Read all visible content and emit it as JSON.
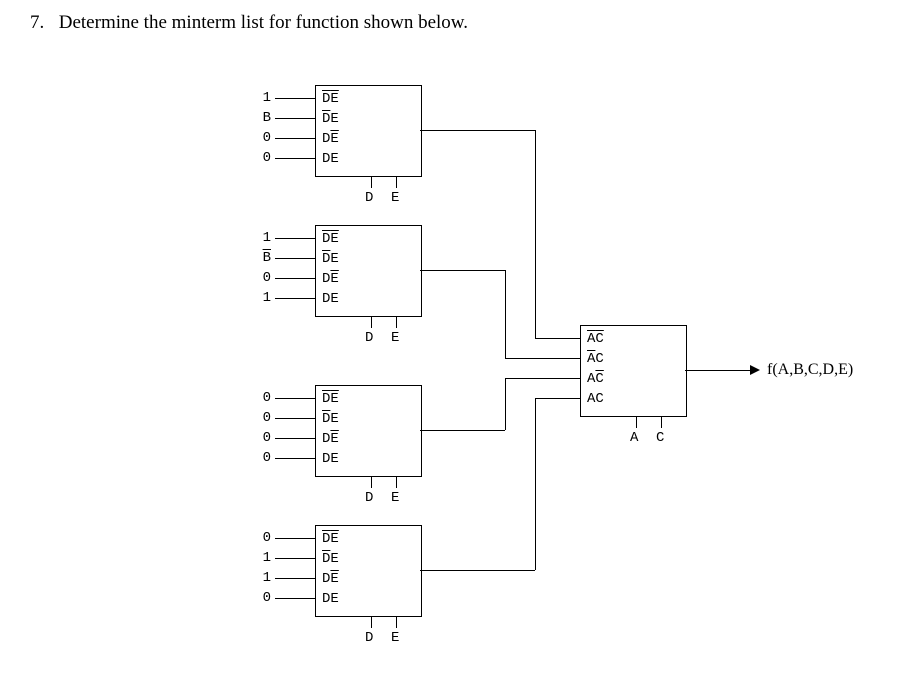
{
  "question": {
    "number": "7.",
    "text": "Determine the minterm list for function shown below."
  },
  "left_muxes": [
    {
      "inputs": [
        "1",
        "B",
        "0",
        "0"
      ],
      "rows": [
        {
          "d": "ovl",
          "e": "ovl"
        },
        {
          "d": "ovl",
          "e": "plain"
        },
        {
          "d": "plain",
          "e": "ovl"
        },
        {
          "d": "plain",
          "e": "plain"
        }
      ],
      "sel": [
        "D",
        "E"
      ]
    },
    {
      "inputs": [
        "1",
        "B̄",
        "0",
        "1"
      ],
      "inputs_raw": [
        "1",
        "Bbar",
        "0",
        "1"
      ],
      "rows": [
        {
          "d": "ovl",
          "e": "ovl"
        },
        {
          "d": "ovl",
          "e": "plain"
        },
        {
          "d": "plain",
          "e": "ovl"
        },
        {
          "d": "plain",
          "e": "plain"
        }
      ],
      "sel": [
        "D",
        "E"
      ]
    },
    {
      "inputs": [
        "0",
        "0",
        "0",
        "0"
      ],
      "rows": [
        {
          "d": "ovl",
          "e": "ovl"
        },
        {
          "d": "ovl",
          "e": "plain"
        },
        {
          "d": "plain",
          "e": "ovl"
        },
        {
          "d": "plain",
          "e": "plain"
        }
      ],
      "sel": [
        "D",
        "E"
      ]
    },
    {
      "inputs": [
        "0",
        "1",
        "1",
        "0"
      ],
      "rows": [
        {
          "d": "ovl",
          "e": "ovl"
        },
        {
          "d": "ovl",
          "e": "plain"
        },
        {
          "d": "plain",
          "e": "ovl"
        },
        {
          "d": "plain",
          "e": "plain"
        }
      ],
      "sel": [
        "D",
        "E"
      ]
    }
  ],
  "right_mux": {
    "rows": [
      {
        "a": "ovl",
        "c": "ovl"
      },
      {
        "a": "ovl",
        "c": "plain"
      },
      {
        "a": "plain",
        "c": "ovl"
      },
      {
        "a": "plain",
        "c": "plain"
      }
    ],
    "sel": [
      "A",
      "C"
    ]
  },
  "output_label": "f(A,B,C,D,E)",
  "glyphs": {
    "D": "D",
    "E": "E",
    "A": "A",
    "C": "C"
  }
}
